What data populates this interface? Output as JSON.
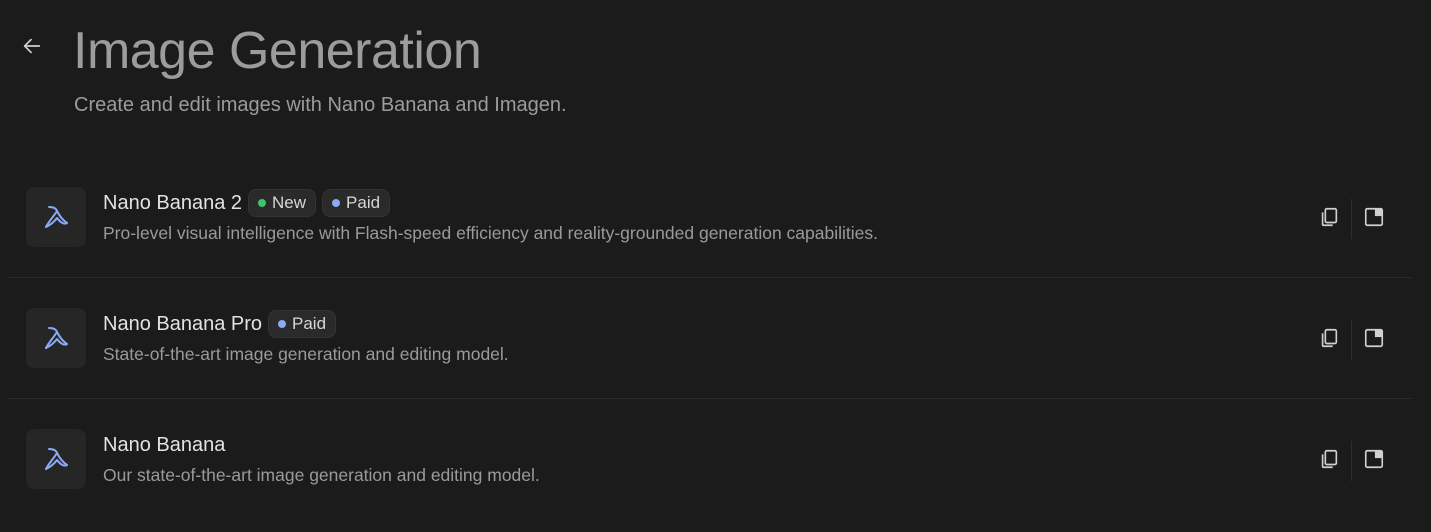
{
  "header": {
    "title": "Image Generation",
    "subtitle": "Create and edit images with Nano Banana and Imagen.",
    "back_icon": "arrow-left-icon"
  },
  "colors": {
    "background": "#1b1b1b",
    "accent_blue": "#8aaaf5",
    "badge_new_dot": "#3ec46d",
    "badge_paid_dot": "#8aaaf5"
  },
  "models": [
    {
      "name": "Nano Banana 2",
      "badges": [
        {
          "label": "New",
          "color": "#3ec46d"
        },
        {
          "label": "Paid",
          "color": "#8aaaf5"
        }
      ],
      "description": "Pro-level visual intelligence with Flash-speed efficiency and reality-grounded generation capabilities.",
      "icon": "banana-icon",
      "actions": [
        "copy-icon",
        "open-panel-icon"
      ]
    },
    {
      "name": "Nano Banana Pro",
      "badges": [
        {
          "label": "Paid",
          "color": "#8aaaf5"
        }
      ],
      "description": "State-of-the-art image generation and editing model.",
      "icon": "banana-icon",
      "actions": [
        "copy-icon",
        "open-panel-icon"
      ]
    },
    {
      "name": "Nano Banana",
      "badges": [],
      "description": "Our state-of-the-art image generation and editing model.",
      "icon": "banana-icon",
      "actions": [
        "copy-icon",
        "open-panel-icon"
      ]
    }
  ]
}
